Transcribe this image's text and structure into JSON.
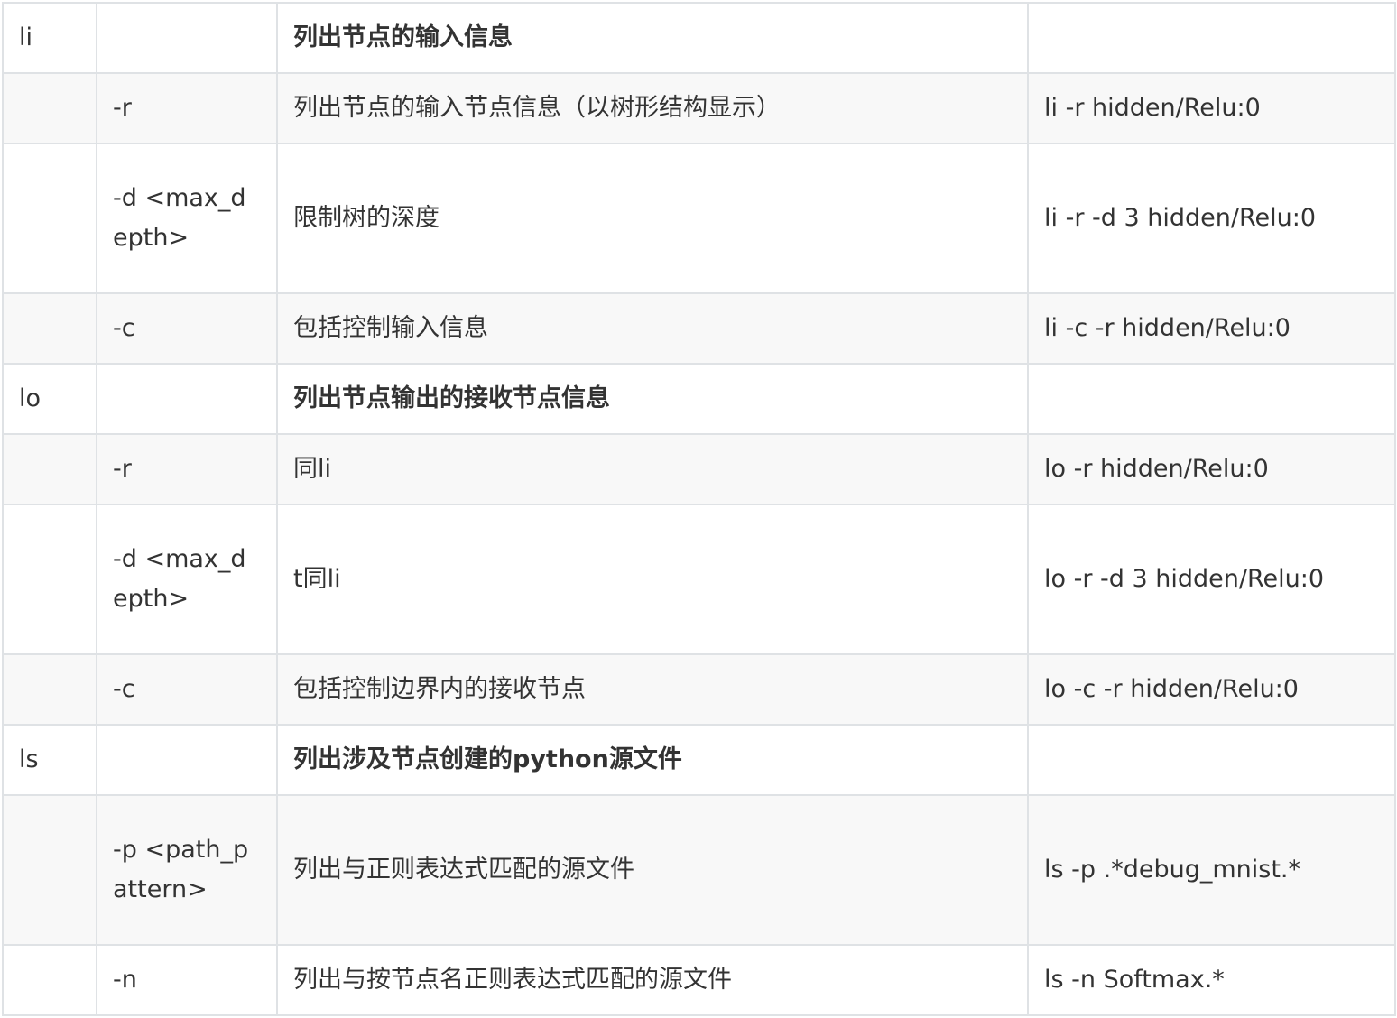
{
  "rows": [
    {
      "cmd": "li",
      "opt": "",
      "desc": "列出节点的输入信息",
      "example": "",
      "bold": true
    },
    {
      "cmd": "",
      "opt": "-r",
      "desc": "列出节点的输入节点信息（以树形结构显示）",
      "example": "li -r hidden/Relu:0"
    },
    {
      "cmd": "",
      "opt": "-d <max_depth>",
      "desc": "限制树的深度",
      "example": "li -r -d 3 hidden/Relu:0"
    },
    {
      "cmd": "",
      "opt": "-c",
      "desc": "包括控制输入信息",
      "example": "li -c -r hidden/Relu:0"
    },
    {
      "cmd": "lo",
      "opt": "",
      "desc": "列出节点输出的接收节点信息",
      "example": "",
      "bold": true
    },
    {
      "cmd": "",
      "opt": "-r",
      "desc": "同li",
      "example": "lo -r hidden/Relu:0"
    },
    {
      "cmd": "",
      "opt": "-d <max_depth>",
      "desc": "t同li",
      "example": "lo -r -d 3 hidden/Relu:0"
    },
    {
      "cmd": "",
      "opt": "-c",
      "desc": "包括控制边界内的接收节点",
      "example": "lo -c -r hidden/Relu:0"
    },
    {
      "cmd": "ls",
      "opt": "",
      "desc": "列出涉及节点创建的python源文件",
      "example": "",
      "bold": true
    },
    {
      "cmd": "",
      "opt": "-p <path_pattern>",
      "desc": "列出与正则表达式匹配的源文件",
      "example": "ls -p .*debug_mnist.*"
    },
    {
      "cmd": "",
      "opt": "-n",
      "desc": "列出与按节点名正则表达式匹配的源文件",
      "example": "ls -n Softmax.*"
    }
  ]
}
